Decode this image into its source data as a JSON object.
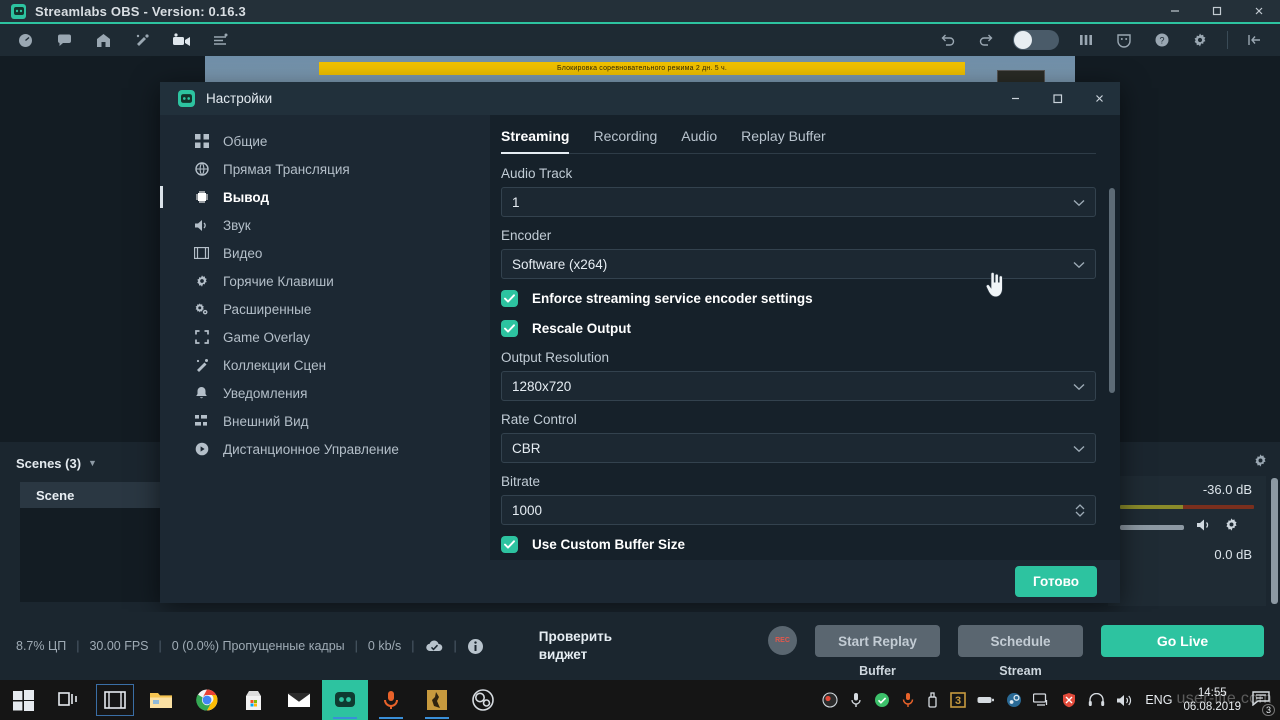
{
  "window": {
    "title": "Streamlabs OBS - Version: 0.16.3",
    "logo_icon": "streamlabs-logo-icon",
    "minimize_icon": "minimize-icon",
    "maximize_icon": "maximize-icon",
    "close_icon": "close-icon"
  },
  "toolbar": {
    "left_icons": [
      "dashboard-icon",
      "chat-icon",
      "store-icon",
      "themes-icon",
      "camera-icon",
      "editor-icon"
    ],
    "right_icons": [
      "undo-icon",
      "redo-icon",
      "night-mode-toggle",
      "mixer-icon",
      "masks-icon",
      "help-icon",
      "settings-gear-icon",
      "collapse-panel-icon"
    ]
  },
  "preview": {
    "banner_text": "Блокировка соревновательного режима 2 дн. 5 ч."
  },
  "scenes_dock": {
    "title": "Scenes (3)",
    "caret_icon": "chevron-down-icon",
    "items": [
      {
        "label": "Scene"
      }
    ]
  },
  "mixer_dock": {
    "gear_icon": "gear-icon",
    "db_top": "-36.0 dB",
    "db_bottom": "0.0 dB",
    "mute_icon": "speaker-icon",
    "settings_icon": "gear-icon"
  },
  "dialog": {
    "title": "Настройки",
    "logo_icon": "streamlabs-logo-icon",
    "minimize_icon": "minimize-icon",
    "maximize_icon": "maximize-icon",
    "close_icon": "close-icon",
    "sidebar": [
      {
        "label": "Общие",
        "icon": "grid-icon"
      },
      {
        "label": "Прямая Трансляция",
        "icon": "globe-icon"
      },
      {
        "label": "Вывод",
        "icon": "chip-icon"
      },
      {
        "label": "Звук",
        "icon": "speaker-icon"
      },
      {
        "label": "Видео",
        "icon": "film-icon"
      },
      {
        "label": "Горячие Клавиши",
        "icon": "gear-icon"
      },
      {
        "label": "Расширенные",
        "icon": "gears-icon"
      },
      {
        "label": "Game Overlay",
        "icon": "fullscreen-icon"
      },
      {
        "label": "Коллекции Сцен",
        "icon": "wand-icon"
      },
      {
        "label": "Уведомления",
        "icon": "bell-icon"
      },
      {
        "label": "Внешний Вид",
        "icon": "appearance-icon"
      },
      {
        "label": "Дистанционное Управление",
        "icon": "play-circle-icon"
      }
    ],
    "active_sidebar_index": 2,
    "tabs": [
      {
        "label": "Streaming"
      },
      {
        "label": "Recording"
      },
      {
        "label": "Audio"
      },
      {
        "label": "Replay Buffer"
      }
    ],
    "active_tab_index": 0,
    "fields": {
      "audio_track_label": "Audio Track",
      "audio_track_value": "1",
      "encoder_label": "Encoder",
      "encoder_value": "Software (x264)",
      "enforce_label": "Enforce streaming service encoder settings",
      "rescale_label": "Rescale Output",
      "output_resolution_label": "Output Resolution",
      "output_resolution_value": "1280x720",
      "rate_control_label": "Rate Control",
      "rate_control_value": "CBR",
      "bitrate_label": "Bitrate",
      "bitrate_value": "1000",
      "custom_buffer_label": "Use Custom Buffer Size",
      "chevron_icon": "chevron-down-icon",
      "spinner_icon": "spinner-arrows-icon",
      "check_icon": "check-icon"
    },
    "done_button": "Готово"
  },
  "statusbar": {
    "cpu": "8.7% ЦП",
    "fps": "30.00 FPS",
    "dropped": "0 (0.0%) Пропущенные кадры",
    "bitrate": "0 kb/s",
    "cloud_icon": "cloud-check-icon",
    "info_icon": "info-icon",
    "widget_check_line1": "Проверить",
    "widget_check_line2": "виджет",
    "rec_label": "REC",
    "start_replay": "Start Replay",
    "buffer_sub": "Buffer",
    "schedule": "Schedule",
    "stream_sub": "Stream",
    "go_live": "Go Live"
  },
  "taskbar": {
    "items": [
      {
        "icon": "windows-start-icon"
      },
      {
        "icon": "task-view-icon"
      },
      {
        "icon": "video-editor-icon"
      },
      {
        "icon": "file-explorer-icon"
      },
      {
        "icon": "chrome-icon"
      },
      {
        "icon": "microsoft-store-icon"
      },
      {
        "icon": "mail-icon"
      },
      {
        "icon": "streamlabs-obs-icon"
      },
      {
        "icon": "audacity-icon"
      },
      {
        "icon": "csgo-icon"
      },
      {
        "icon": "obs-studio-icon"
      }
    ],
    "tray": [
      {
        "icon": "obs-tray-icon"
      },
      {
        "icon": "microphone-tray-icon"
      },
      {
        "icon": "antivirus-tray-icon"
      },
      {
        "icon": "audacity-tray-icon"
      },
      {
        "icon": "usb-tray-icon"
      },
      {
        "icon": "3-badge-tray-icon"
      },
      {
        "icon": "battery-tray-icon"
      },
      {
        "icon": "steam-tray-icon"
      },
      {
        "icon": "network-tray-icon"
      },
      {
        "icon": "shield-tray-icon"
      },
      {
        "icon": "headset-tray-icon"
      },
      {
        "icon": "volume-tray-icon"
      }
    ],
    "language": "ENG",
    "time": "14:55",
    "date": "06.08.2019",
    "notification_icon": "notification-icon",
    "notification_count": "3"
  },
  "watermark": "user-life.com",
  "colors": {
    "accent_teal": "#2dc3a0",
    "window_bg": "#1b262f",
    "dialog_bg": "#1c2833",
    "content_bg": "#16212a",
    "banner_yellow": "#f2c200"
  }
}
